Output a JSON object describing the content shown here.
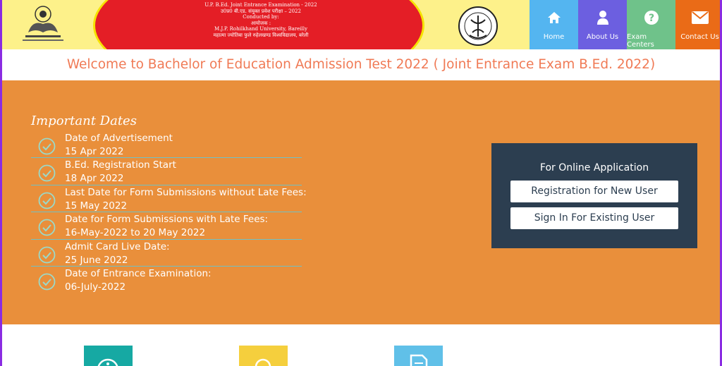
{
  "header": {
    "banner_lines": [
      "U.P. B.Ed. Joint Entrance Examination - 2022",
      "उ0प्र0 बी.एड. संयुक्त प्रवेश परीक्षा – 2022",
      "Conducted by:",
      "आयोजक :",
      "M.J.P. Rohilkhand University, Bareilly",
      "महात्मा ज्योतिबा फुले रुहेलखण्ड विश्वविद्यालय, बरेली"
    ]
  },
  "nav": [
    {
      "label": "Home",
      "icon": "home-icon",
      "color": "#54b5f0"
    },
    {
      "label": "About Us",
      "icon": "user-icon",
      "color": "#6c5fe0"
    },
    {
      "label": "Exam Centers",
      "icon": "question-icon",
      "color": "#6fc28a"
    },
    {
      "label": "Contact Us",
      "icon": "envelope-icon",
      "color": "#ea6b17"
    }
  ],
  "welcome": "Welcome to Bachelor of Education Admission Test 2022 ( Joint Entrance Exam B.Ed. 2022)",
  "important_dates": {
    "title": "Important Dates",
    "items": [
      {
        "label": "Date of Advertisement",
        "value": "15 Apr 2022"
      },
      {
        "label": "B.Ed. Registration Start",
        "value": "18 Apr 2022"
      },
      {
        "label": "Last Date for Form Submissions without Late Fees:",
        "value": "15 May 2022"
      },
      {
        "label": "Date for Form Submissions with Late Fees:",
        "value": "16-May-2022 to 20 May 2022"
      },
      {
        "label": "Admit Card Live Date:",
        "value": "25 June 2022"
      },
      {
        "label": "Date of Entrance Examination:",
        "value": "06-July-2022"
      }
    ]
  },
  "online_application": {
    "title": "For Online Application",
    "register_label": "Registration for New User",
    "signin_label": "Sign In For Existing User"
  },
  "tiles": [
    {
      "icon": "info-icon",
      "color": "#16a9a3"
    },
    {
      "icon": "search-user-icon",
      "color": "#f5cf3d"
    },
    {
      "icon": "document-icon",
      "color": "#60c0e8"
    }
  ],
  "colors": {
    "orange_bg": "#e98f3b",
    "header_yellow": "#fdf18a",
    "banner_red": "#e41e26",
    "panel_navy": "#2c3e50",
    "welcome_text": "#f07a55"
  }
}
